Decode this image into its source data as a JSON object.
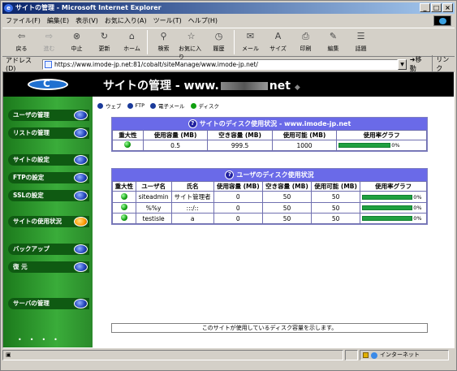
{
  "window": {
    "title": "サイトの管理 - Microsoft Internet Explorer"
  },
  "menu": [
    "ファイル(F)",
    "編集(E)",
    "表示(V)",
    "お気に入り(A)",
    "ツール(T)",
    "ヘルプ(H)"
  ],
  "toolbar": [
    {
      "label": "戻る",
      "icon": "back-icon"
    },
    {
      "label": "進む",
      "icon": "forward-icon"
    },
    {
      "label": "中止",
      "icon": "stop-icon"
    },
    {
      "label": "更新",
      "icon": "refresh-icon"
    },
    {
      "label": "ホーム",
      "icon": "home-icon"
    },
    {
      "label": "検索",
      "icon": "search-icon"
    },
    {
      "label": "お気に入り",
      "icon": "favorites-icon"
    },
    {
      "label": "履歴",
      "icon": "history-icon"
    },
    {
      "label": "メール",
      "icon": "mail-icon"
    },
    {
      "label": "サイズ",
      "icon": "font-size-icon"
    },
    {
      "label": "印刷",
      "icon": "print-icon"
    },
    {
      "label": "編集",
      "icon": "edit-icon"
    },
    {
      "label": "話題",
      "icon": "discuss-icon"
    }
  ],
  "address": {
    "label": "アドレス(D)",
    "url": "https://www.imode-jp.net:81/cobalt/siteManage/www.imode-jp.net/",
    "go": "移動",
    "links": "リンク"
  },
  "banner": {
    "title_prefix": "サイトの管理 - www.",
    "title_suffix": "net"
  },
  "sidebar": [
    {
      "label": "ユーザの管理"
    },
    {
      "label": "リストの管理"
    },
    {
      "label": "サイトの設定"
    },
    {
      "label": "FTPの設定"
    },
    {
      "label": "SSLの設定"
    },
    {
      "label": "サイトの使用状況",
      "active": true
    },
    {
      "label": "バックアップ"
    },
    {
      "label": "復 元"
    },
    {
      "label": "サーバの管理"
    }
  ],
  "legend": [
    {
      "label": "ウェブ",
      "color": "#1a3a9a"
    },
    {
      "label": "FTP",
      "color": "#1a3a9a"
    },
    {
      "label": "電子メール",
      "color": "#1a3a9a"
    },
    {
      "label": "ディスク",
      "color": "#10a010"
    }
  ],
  "site_disk": {
    "title": "サイトのディスク使用状況 - www.imode-jp.net",
    "headers": [
      "重大性",
      "使用容量 (MB)",
      "空き容量 (MB)",
      "使用可能 (MB)",
      "使用率グラフ"
    ],
    "rows": [
      {
        "used": "0.5",
        "free": "999.5",
        "avail": "1000",
        "pct": "0%",
        "pct_value": 0.0005
      }
    ]
  },
  "user_disk": {
    "title": "ユーザのディスク使用状況",
    "headers": [
      "重大性",
      "ユーザ名",
      "氏名",
      "使用容量 (MB)",
      "空き容量 (MB)",
      "使用可能 (MB)",
      "使用率グラフ"
    ],
    "rows": [
      {
        "user": "siteadmin",
        "name": "サイト管理者",
        "used": "0",
        "free": "50",
        "avail": "50",
        "pct": "0%"
      },
      {
        "user": "%%y",
        "name": ":::/::",
        "used": "0",
        "free": "50",
        "avail": "50",
        "pct": "0%"
      },
      {
        "user": "testisle",
        "name": "a",
        "used": "0",
        "free": "50",
        "avail": "50",
        "pct": "0%"
      }
    ]
  },
  "message": "このサイトが使用しているディスク容量を示します。",
  "status": {
    "zone": "インターネット"
  }
}
